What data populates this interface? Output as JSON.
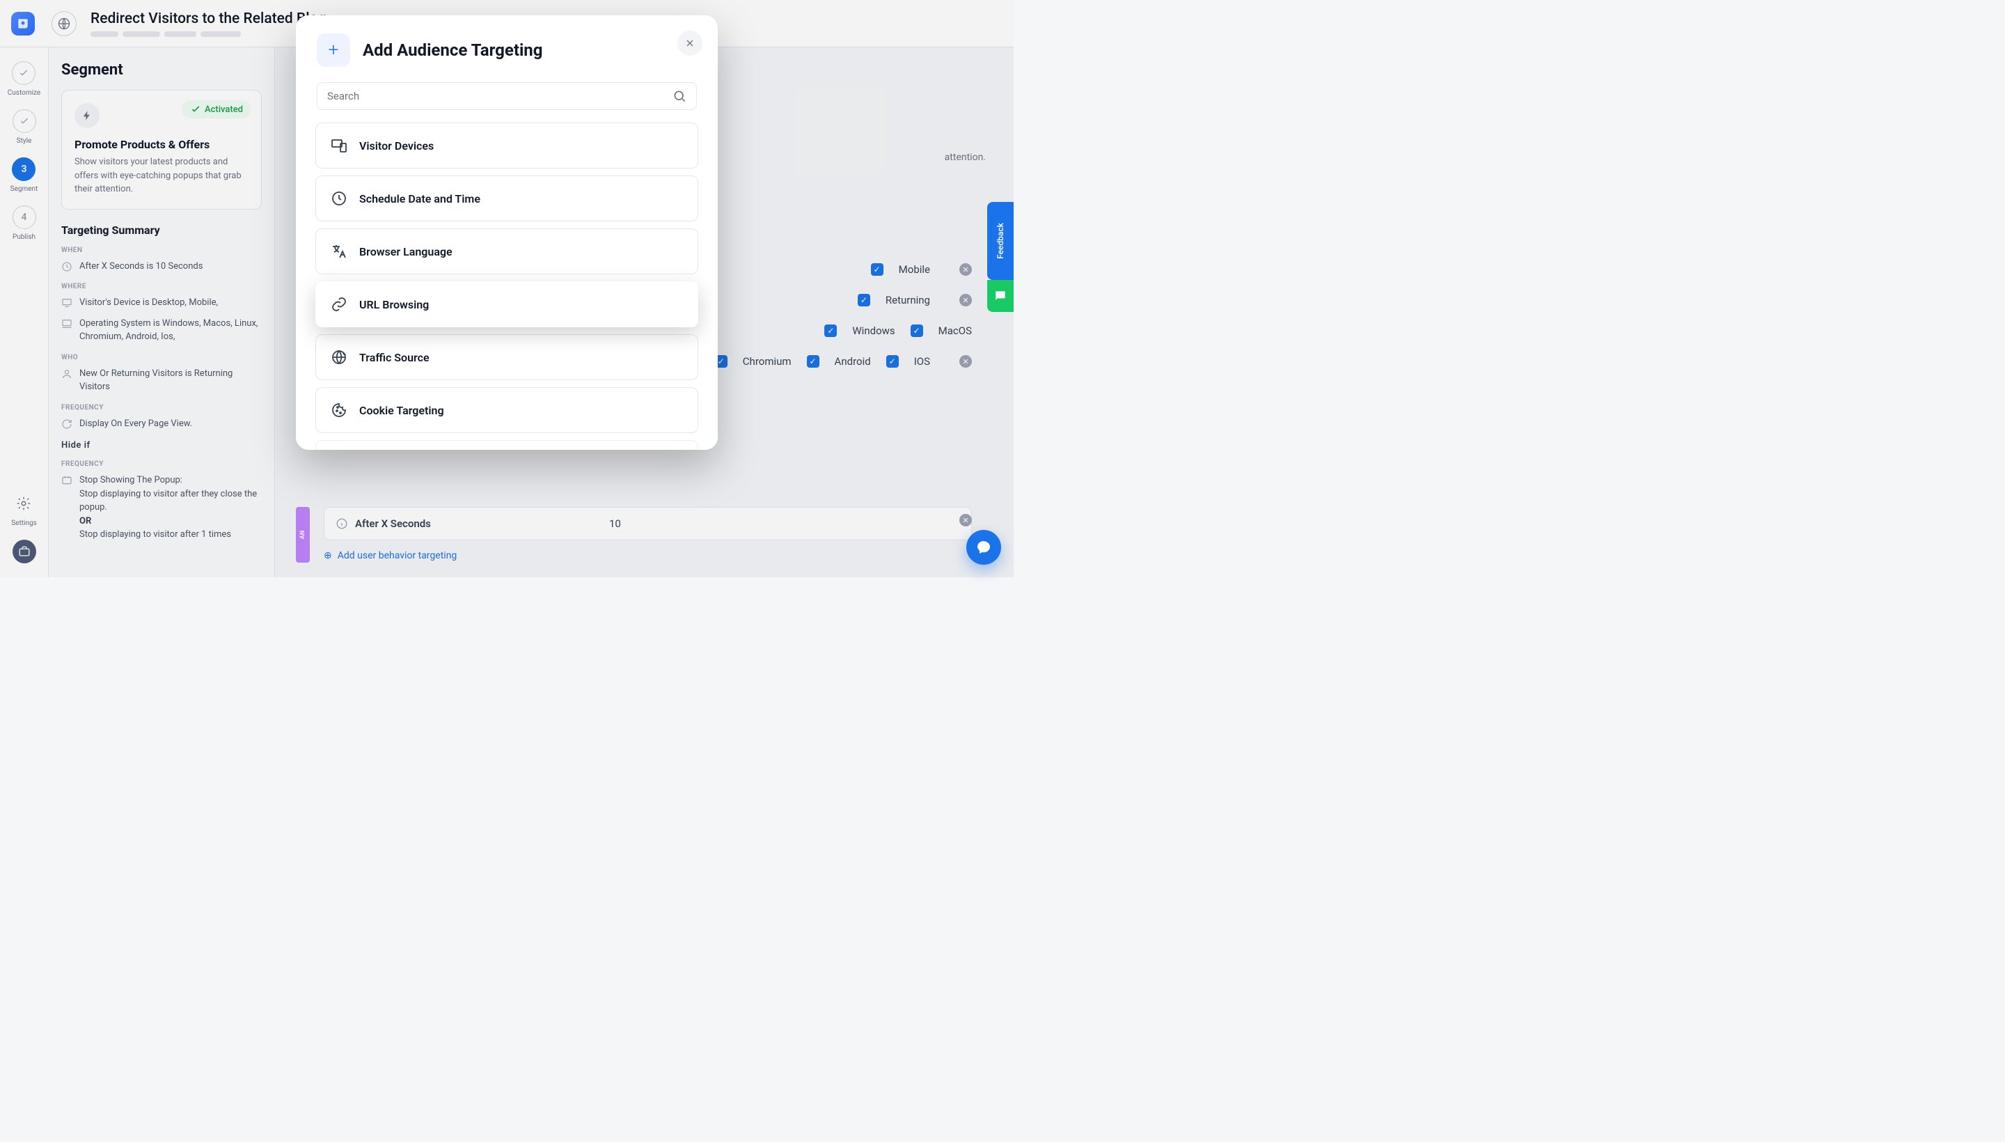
{
  "header": {
    "page_title": "Redirect Visitors to the Related Blog ..."
  },
  "rail": {
    "customize": "Customize",
    "style": "Style",
    "segment_num": "3",
    "segment": "Segment",
    "publish_num": "4",
    "publish": "Publish",
    "settings": "Settings"
  },
  "panel": {
    "title": "Segment",
    "badge": "Activated",
    "card_name": "Promote Products & Offers",
    "card_desc": "Show visitors your latest products and offers with eye-catching popups that grab their attention.",
    "targeting_summary": "Targeting Summary",
    "when": "WHEN",
    "when_text": "After X Seconds is 10 Seconds",
    "where": "WHERE",
    "where_1": "Visitor's Device is Desktop, Mobile,",
    "where_2": "Operating System is Windows, Macos, Linux, Chromium, Android, Ios,",
    "who": "WHO",
    "who_text": "New Or Returning Visitors is Returning Visitors",
    "frequency": "FREQUENCY",
    "freq_text": "Display On Every Page View.",
    "hide_if": "Hide if",
    "hide_label": "FREQUENCY",
    "hide_1": "Stop Showing The Popup:",
    "hide_2": "Stop displaying to visitor after they close the popup.",
    "hide_or": "OR",
    "hide_3": "Stop displaying to visitor after 1 times"
  },
  "bg": {
    "attention_tail": "attention.",
    "mobile": "Mobile",
    "returning": "Returning",
    "windows": "Windows",
    "macos": "MacOS",
    "chromium": "Chromium",
    "android": "Android",
    "ios": "IOS",
    "after_label": "After X Seconds",
    "after_value": "10",
    "add_behavior": "Add user behavior targeting",
    "band": "AN"
  },
  "modal": {
    "title": "Add Audience Targeting",
    "search_placeholder": "Search",
    "options": [
      "Visitor Devices",
      "Schedule Date and Time",
      "Browser Language",
      "URL Browsing",
      "Traffic Source",
      "Cookie Targeting"
    ]
  },
  "feedback": {
    "label": "Feedback"
  }
}
